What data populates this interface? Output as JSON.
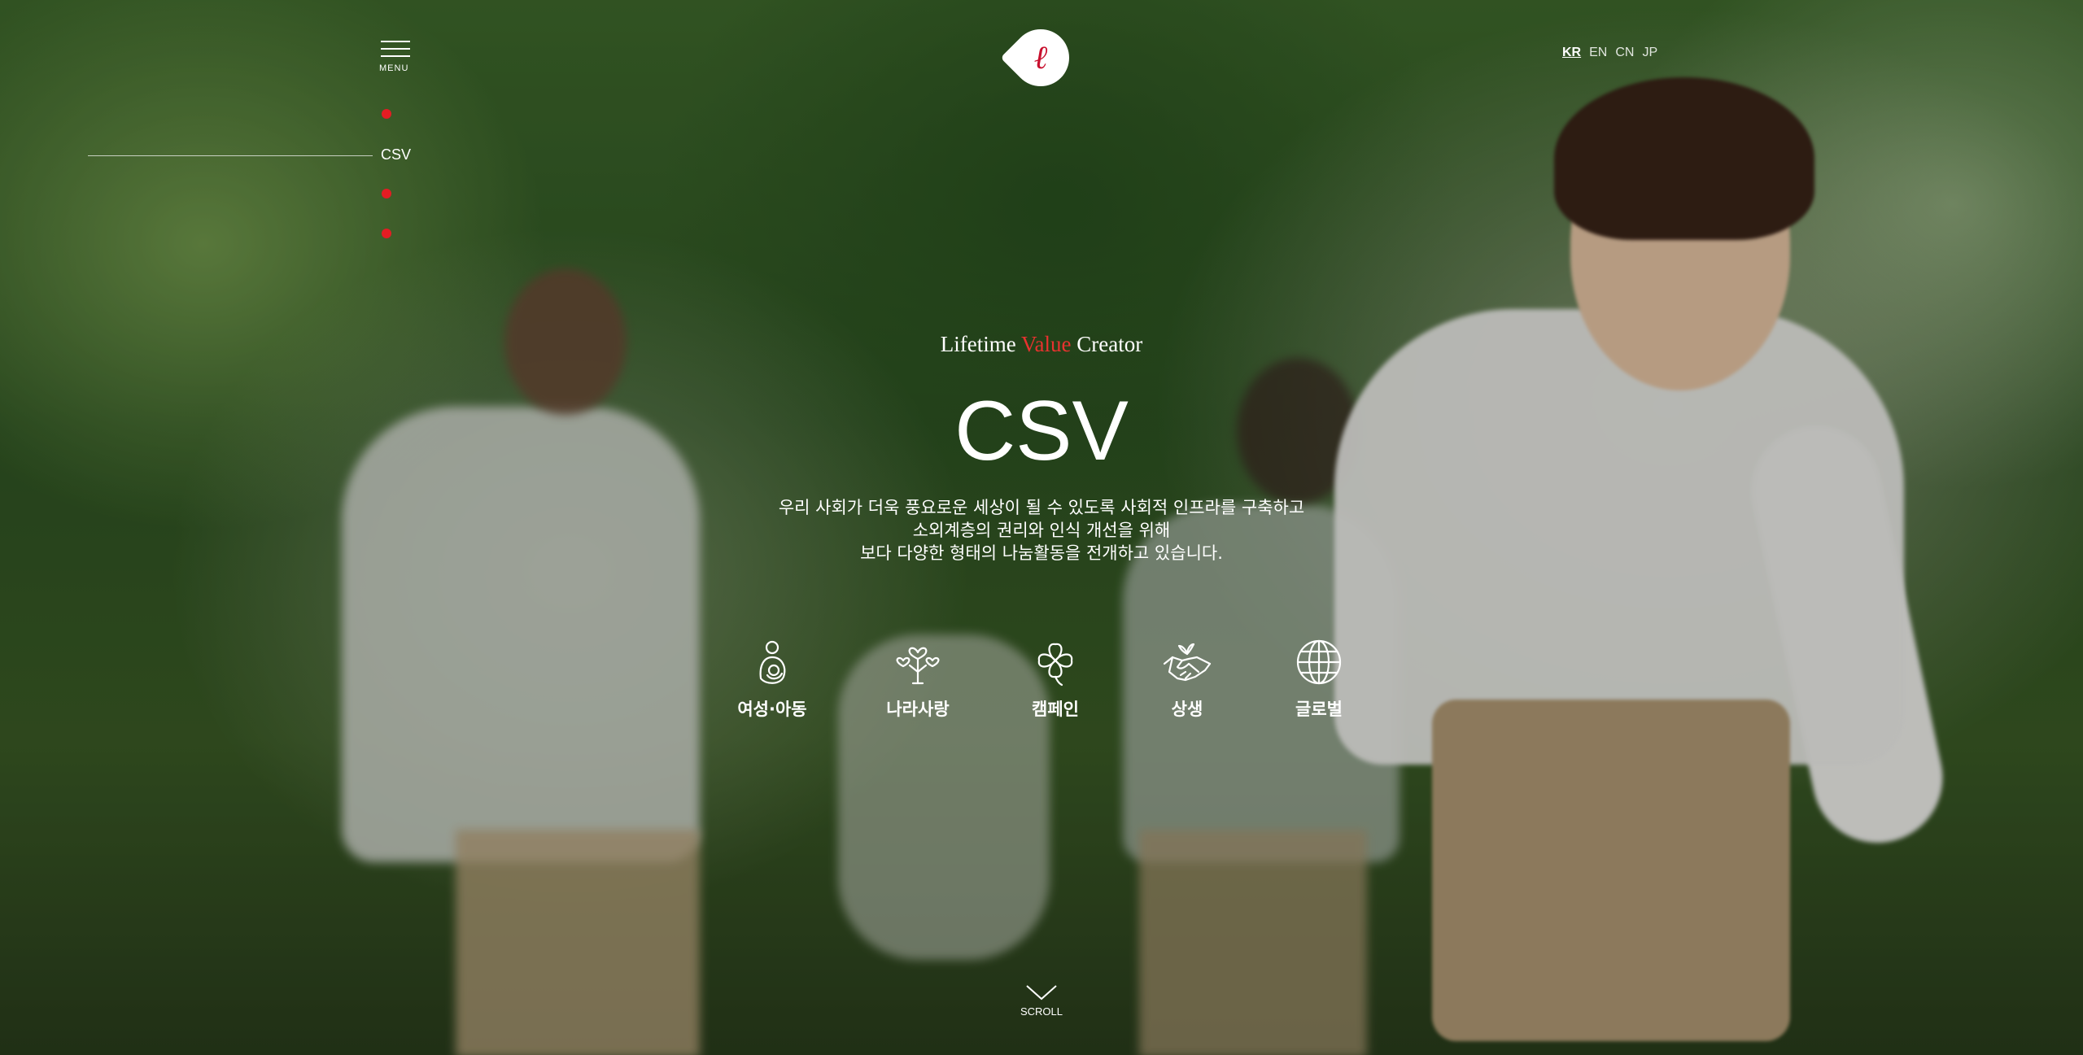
{
  "header": {
    "menu_label": "MENU",
    "logo_glyph": "ℓ",
    "languages": [
      {
        "code": "KR",
        "active": true
      },
      {
        "code": "EN",
        "active": false
      },
      {
        "code": "CN",
        "active": false
      },
      {
        "code": "JP",
        "active": false
      }
    ]
  },
  "side_nav": {
    "active_label": "CSV",
    "dot_color": "#e51c23"
  },
  "hero": {
    "tagline_before": "Lifetime ",
    "tagline_accent": "Value",
    "tagline_after": " Creator",
    "accent_color": "#e8322f",
    "title": "CSV",
    "description": [
      "우리 사회가 더욱 풍요로운 세상이 될 수 있도록 사회적 인프라를 구축하고",
      "소외계층의 권리와 인식 개선을 위해",
      "보다 다양한 형태의 나눔활동을 전개하고 있습니다."
    ]
  },
  "categories": [
    {
      "label": "여성·아동",
      "icon": "mother-child-icon"
    },
    {
      "label": "나라사랑",
      "icon": "heart-tree-icon"
    },
    {
      "label": "캠페인",
      "icon": "clover-icon"
    },
    {
      "label": "상생",
      "icon": "handshake-icon"
    },
    {
      "label": "글로벌",
      "icon": "globe-icon"
    }
  ],
  "scroll": {
    "label": "SCROLL",
    "icon": "chevron-down-icon"
  }
}
